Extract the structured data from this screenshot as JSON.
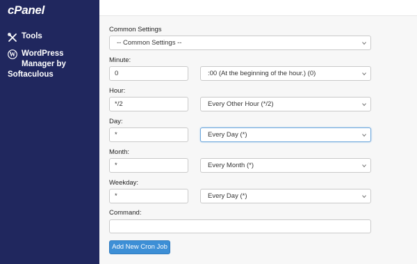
{
  "sidebar": {
    "logo": "cPanel",
    "tools_label": "Tools",
    "wordpress_line1": "WordPress",
    "wordpress_line2": "Manager by",
    "wordpress_line3": "Softaculous"
  },
  "form": {
    "common_settings": {
      "label": "Common Settings",
      "selected": "-- Common Settings --"
    },
    "minute": {
      "label": "Minute:",
      "value": "0",
      "selected": ":00 (At the beginning of the hour.) (0)"
    },
    "hour": {
      "label": "Hour:",
      "value": "*/2",
      "selected": "Every Other Hour (*/2)"
    },
    "day": {
      "label": "Day:",
      "value": "*",
      "selected": "Every Day (*)"
    },
    "month": {
      "label": "Month:",
      "value": "*",
      "selected": "Every Month (*)"
    },
    "weekday": {
      "label": "Weekday:",
      "value": "*",
      "selected": "Every Day (*)"
    },
    "command": {
      "label": "Command:",
      "value": ""
    },
    "submit_label": "Add New Cron Job"
  },
  "colors": {
    "sidebar_bg": "#20275e",
    "button_bg": "#3d8fd6"
  }
}
